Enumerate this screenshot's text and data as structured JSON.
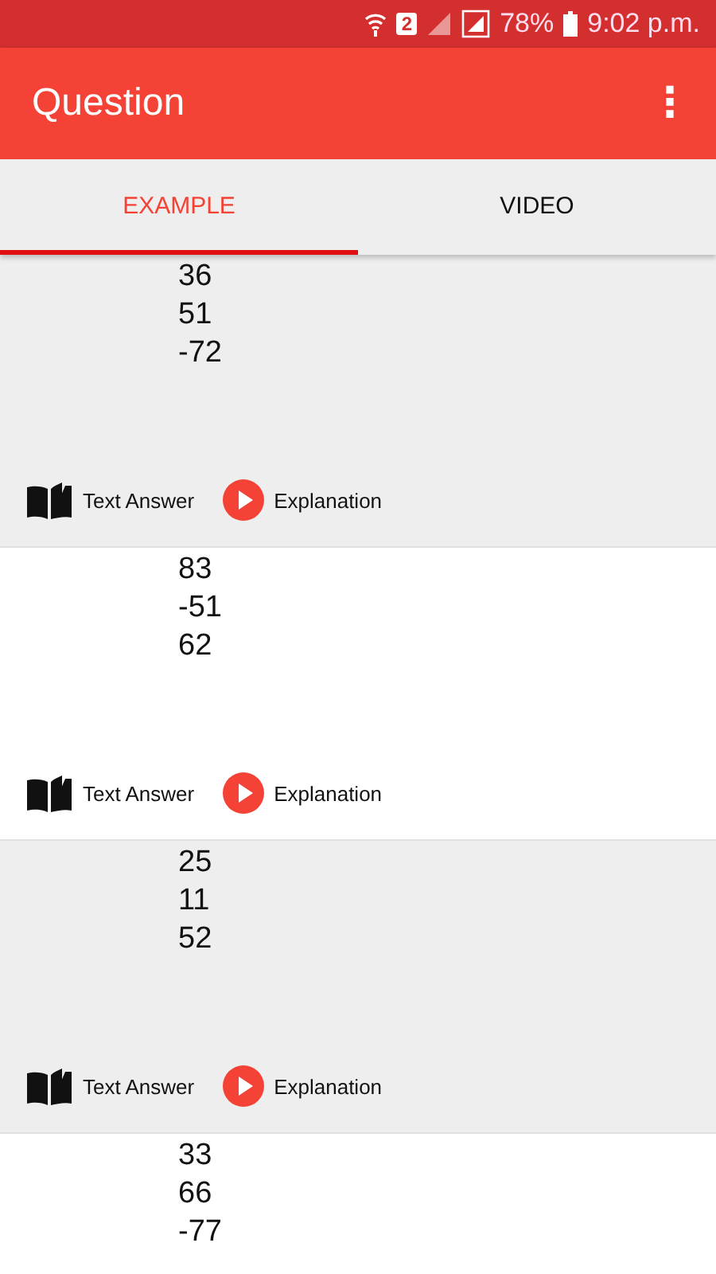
{
  "status_bar": {
    "sim": "2",
    "battery": "78%",
    "time": "9:02 p.m."
  },
  "app_bar": {
    "title": "Question",
    "menu": "⋮"
  },
  "tabs": [
    {
      "label": "EXAMPLE",
      "selected": true
    },
    {
      "label": "VIDEO",
      "selected": false
    }
  ],
  "cards": [
    {
      "numbers": [
        "36",
        "51",
        "-72"
      ],
      "actions": [
        {
          "kind": "book",
          "label": "Text Answer"
        },
        {
          "kind": "play",
          "label": "Explanation"
        }
      ]
    },
    {
      "numbers": [
        "83",
        "-51",
        "62"
      ],
      "actions": [
        {
          "kind": "book",
          "label": "Text Answer"
        },
        {
          "kind": "play",
          "label": "Explanation"
        }
      ]
    },
    {
      "numbers": [
        "25",
        "11",
        "52"
      ],
      "actions": [
        {
          "kind": "book",
          "label": "Text Answer"
        },
        {
          "kind": "play",
          "label": "Explanation"
        }
      ]
    },
    {
      "numbers": [
        "33",
        "66",
        "-77"
      ]
    }
  ]
}
